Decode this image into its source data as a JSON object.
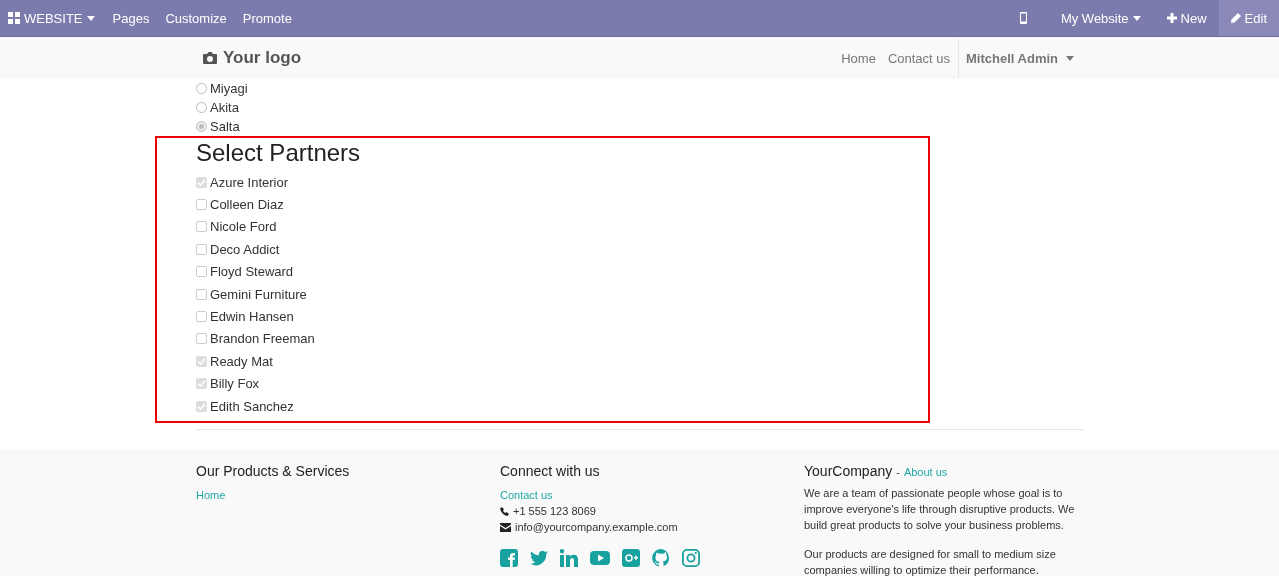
{
  "top_bar": {
    "app_menu": "WEBSITE",
    "menus": [
      "Pages",
      "Customize",
      "Promote"
    ],
    "website_menu": "My Website",
    "new_button": "New",
    "edit_button": "Edit"
  },
  "navbar": {
    "logo": "Your logo",
    "links": [
      "Home",
      "Contact us"
    ],
    "user_menu": "Mitchell Admin"
  },
  "regions": [
    {
      "label": "Miyagi",
      "selected": false
    },
    {
      "label": "Akita",
      "selected": false
    },
    {
      "label": "Salta",
      "selected": true
    }
  ],
  "partners": {
    "title": "Select Partners",
    "items": [
      {
        "label": "Azure Interior",
        "checked": true
      },
      {
        "label": "Colleen Diaz",
        "checked": false
      },
      {
        "label": "Nicole Ford",
        "checked": false
      },
      {
        "label": "Deco Addict",
        "checked": false
      },
      {
        "label": "Floyd Steward",
        "checked": false
      },
      {
        "label": "Gemini Furniture",
        "checked": false
      },
      {
        "label": "Edwin Hansen",
        "checked": false
      },
      {
        "label": "Brandon Freeman",
        "checked": false
      },
      {
        "label": "Ready Mat",
        "checked": true
      },
      {
        "label": "Billy Fox",
        "checked": true
      },
      {
        "label": "Edith Sanchez",
        "checked": true
      }
    ]
  },
  "footer": {
    "products": {
      "title": "Our Products & Services",
      "links": [
        "Home"
      ]
    },
    "connect": {
      "title": "Connect with us",
      "contact_link": "Contact us",
      "phone": "+1 555 123 8069",
      "email": "info@yourcompany.example.com"
    },
    "about": {
      "title": "YourCompany",
      "separator": "-",
      "link": "About us",
      "paragraphs": [
        "We are a team of passionate people whose goal is to improve everyone's life through disruptive products. We build great products to solve your business problems.",
        "Our products are designed for small to medium size companies willing to optimize their performance."
      ]
    }
  }
}
